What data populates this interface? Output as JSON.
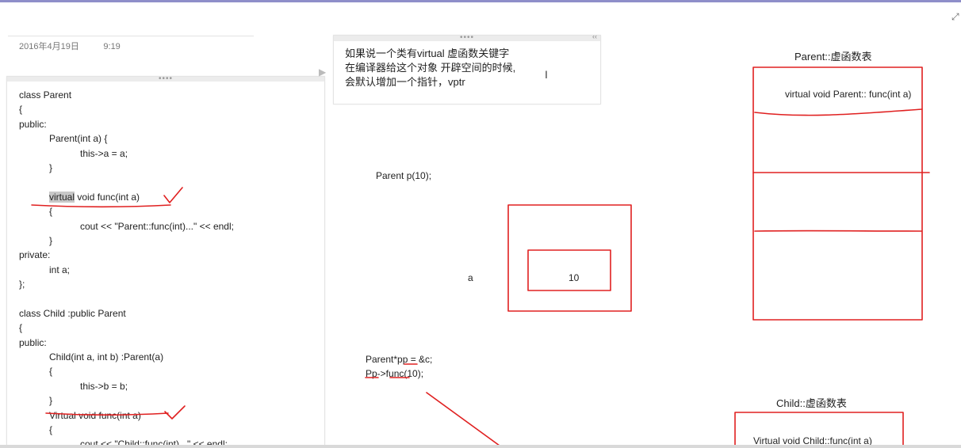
{
  "meta": {
    "date": "2016年4月19日",
    "time": "9:19"
  },
  "code_panel": {
    "lines": [
      {
        "indent": 0,
        "text": "class Parent"
      },
      {
        "indent": 0,
        "text": "{"
      },
      {
        "indent": 0,
        "text": "public:"
      },
      {
        "indent": 1,
        "text": "Parent(int a) {"
      },
      {
        "indent": 2,
        "text": "this->a = a;"
      },
      {
        "indent": 1,
        "text": "}"
      },
      {
        "indent": 0,
        "text": ""
      },
      {
        "indent": 1,
        "highlight": "virtual",
        "text": " void func(int a)"
      },
      {
        "indent": 1,
        "text": "{"
      },
      {
        "indent": 2,
        "text": "cout << \"Parent::func(int)...\" << endl;"
      },
      {
        "indent": 1,
        "text": "}"
      },
      {
        "indent": 0,
        "text": "private:"
      },
      {
        "indent": 1,
        "text": "int a;"
      },
      {
        "indent": 0,
        "text": "};"
      },
      {
        "indent": 0,
        "text": ""
      },
      {
        "indent": 0,
        "text": "class Child :public Parent"
      },
      {
        "indent": 0,
        "text": "{"
      },
      {
        "indent": 0,
        "text": "public:"
      },
      {
        "indent": 1,
        "text": "Child(int a, int b) :Parent(a)"
      },
      {
        "indent": 1,
        "text": "{"
      },
      {
        "indent": 2,
        "text": "this->b = b;"
      },
      {
        "indent": 1,
        "text": "}"
      },
      {
        "indent": 1,
        "text": "Virtual void func(int a)"
      },
      {
        "indent": 1,
        "text": "{"
      },
      {
        "indent": 2,
        "text": "cout << \"Child::func(int)...\" << endl;"
      }
    ]
  },
  "note": {
    "lines": [
      "如果说一个类有virtual  虚函数关键字",
      "在编译器给这个对象 开辟空间的时候,",
      "会默认增加一个指针，vptr"
    ]
  },
  "canvas": {
    "parent_decl": "Parent p(10);",
    "member_label": "a",
    "member_value": "10",
    "pointer_decl": "Parent*pp = &c;",
    "pointer_call": "Pp->func(10);",
    "parent_vtable_title": "Parent::虚函数表",
    "parent_vtable_entry": "virtual void Parent:: func(int a)",
    "child_vtable_title": "Child::虚函数表",
    "child_vtable_entry": "Virtual void Child::func(int a)"
  },
  "icons": {
    "panel_grip": "grip-dots-icon",
    "expand": "expand-arrow-icon",
    "text_cursor": "text-cursor-icon",
    "close": "close-icon"
  },
  "colors": {
    "ink_red": "#e02020",
    "accent_strip": "#8e8ec9"
  }
}
